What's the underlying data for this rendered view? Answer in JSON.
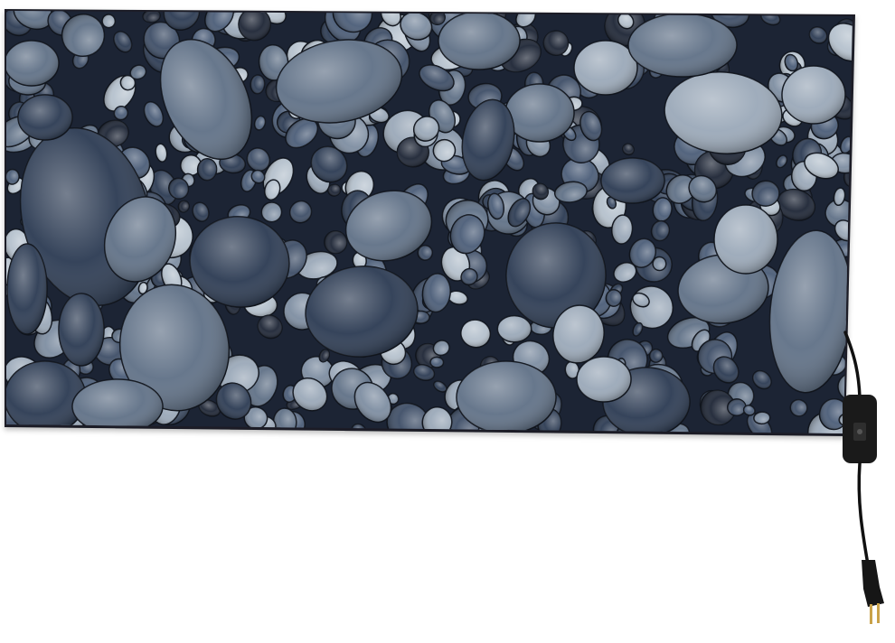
{
  "product": {
    "subject": "wall-mounted-infrared-heater-panel",
    "panel_pattern": "river-pebbles",
    "has_inline_switch": true,
    "has_plug": true
  },
  "colors": {
    "background": "#ffffff",
    "frame": "#1b1f26",
    "pebble_base": "#2b3a52",
    "pebble_light": "#9aa8b8",
    "pebble_mid": "#5f7086",
    "pebble_dark": "#1c2434",
    "cable": "#111111",
    "switch_body": "#1a1a1a",
    "plug_pins": "#c9a24a"
  }
}
